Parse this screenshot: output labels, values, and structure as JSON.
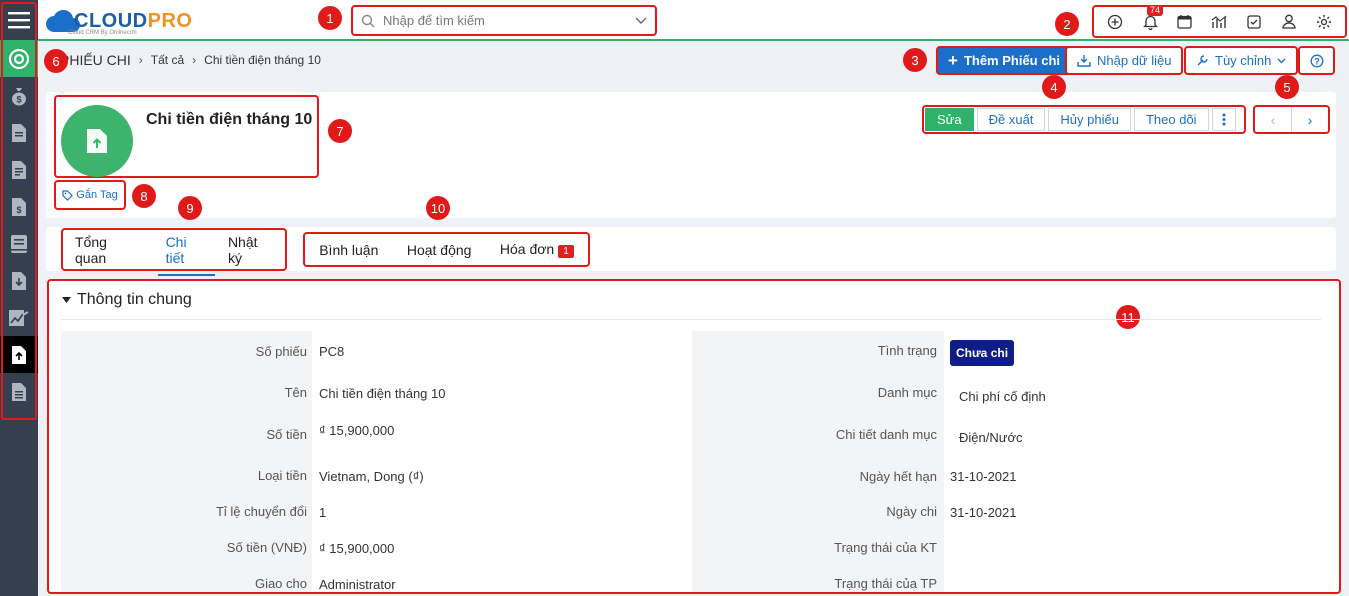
{
  "app": {
    "logo_main": "CLOUD",
    "logo_accent": "PRO",
    "logo_tagline": "Cloud CRM By Onlinecrm"
  },
  "search": {
    "placeholder": "Nhập để tìm kiếm"
  },
  "notifications": {
    "count": "74"
  },
  "breadcrumb": {
    "module": "PHIẾU CHI",
    "all": "Tất cả",
    "current": "Chi tiền điện tháng 10"
  },
  "toolbar": {
    "add_label": "Thêm Phiếu chi",
    "import_label": "Nhập dữ liệu",
    "customize_label": "Tùy chỉnh"
  },
  "record": {
    "title": "Chi tiền điện tháng 10",
    "tag_label": "Gắn Tag",
    "actions": [
      "Sửa",
      "Đề xuất",
      "Hủy phiếu",
      "Theo dõi"
    ]
  },
  "tabs_main": [
    "Tổng quan",
    "Chi tiết",
    "Nhật ký"
  ],
  "tabs_extra": {
    "comments": "Bình luận",
    "activities": "Hoạt động",
    "invoices": "Hóa đơn",
    "invoices_count": "1"
  },
  "section": {
    "title": "Thông tin chung"
  },
  "fields_left": [
    {
      "label": "Số phiếu",
      "value": "PC8"
    },
    {
      "label": "Tên",
      "value": "Chi tiền điện tháng 10"
    },
    {
      "label": "Số tiền",
      "value": "₫ 15,900,000"
    },
    {
      "label": "Loại tiền",
      "value": "Vietnam, Dong (₫)"
    },
    {
      "label": "Tỉ lệ chuyển đổi",
      "value": "1"
    },
    {
      "label": "Số tiền (VNĐ)",
      "value": "₫ 15,900,000"
    },
    {
      "label": "Giao cho",
      "value": "Administrator"
    }
  ],
  "fields_right": [
    {
      "label": "Tình trạng",
      "value": "Chưa chi"
    },
    {
      "label": "Danh mục",
      "value": "Chi phí cố định"
    },
    {
      "label": "Chi tiết danh mục",
      "value": "Điện/Nước"
    },
    {
      "label": "Ngày hết hạn",
      "value": "31-10-2021"
    },
    {
      "label": "Ngày chi",
      "value": "31-10-2021"
    },
    {
      "label": "Trạng thái của KT",
      "value": ""
    },
    {
      "label": "Trạng thái của TP",
      "value": ""
    }
  ],
  "callouts": [
    "1",
    "2",
    "3",
    "4",
    "5",
    "6",
    "7",
    "8",
    "9",
    "10",
    "11"
  ],
  "colors": {
    "brand_green": "#2fb26a",
    "primary_blue": "#1b6fc9",
    "annotation_red": "#e01919",
    "status_navy": "#0f1e86"
  },
  "sidebar_icons": [
    "menu-icon",
    "home-icon",
    "money-bag-icon",
    "document-icon",
    "document-list-icon",
    "invoice-icon",
    "book-icon",
    "download-icon",
    "chart-icon",
    "upload-icon",
    "file-icon"
  ]
}
